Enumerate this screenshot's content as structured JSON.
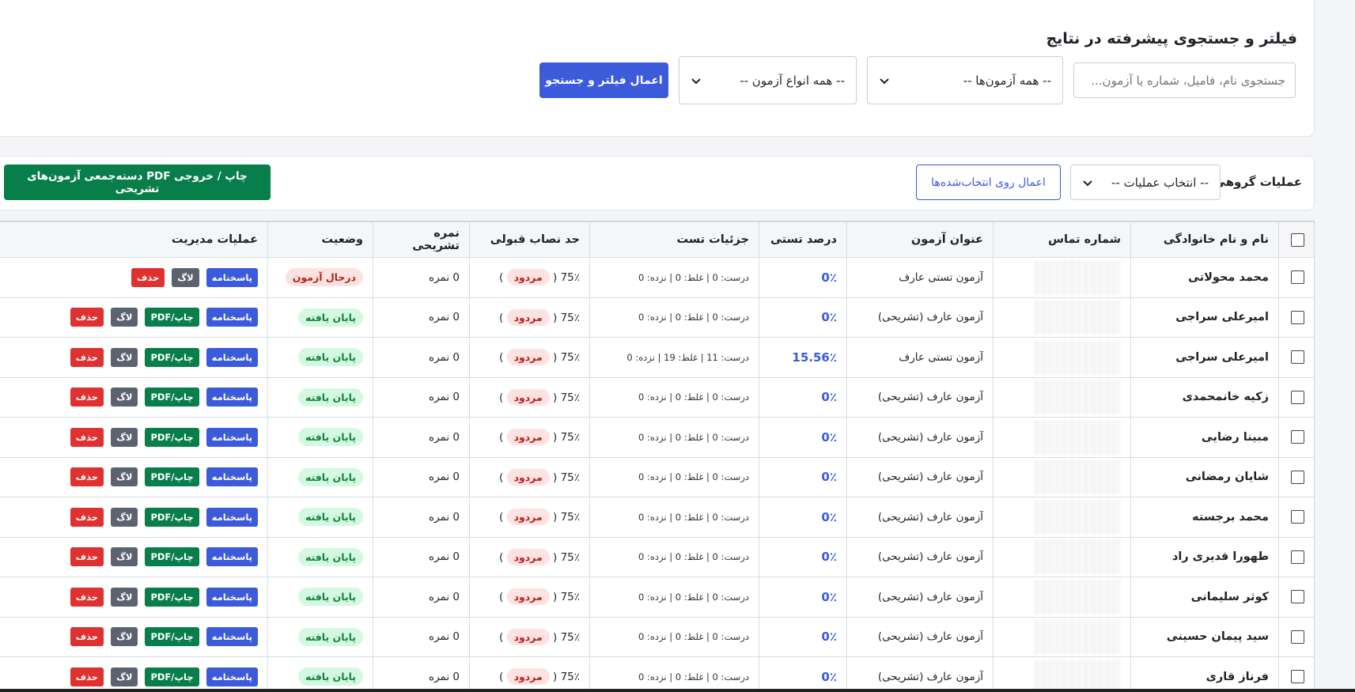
{
  "filter": {
    "title": "فیلتر و جستجوی پیشرفته در نتایج",
    "search_placeholder": "جستجوی نام، فامیل، شماره یا آزمون...",
    "exams_select": "-- همه آزمون‌ها --",
    "types_select": "-- همه انواع آزمون --",
    "apply_label": "اعمال فیلتر و جستجو"
  },
  "bulk": {
    "label": "عملیات گروهی:",
    "select": "-- انتخاب عملیات --",
    "apply_label": "اعمال روی انتخاب‌شده‌ها",
    "pdf_label": "چاپ / خروجی PDF دسته‌جمعی آزمون‌های تشریحی"
  },
  "table": {
    "headers": {
      "name": "نام و نام خانوادگی",
      "phone": "شماره تماس",
      "title": "عنوان آزمون",
      "pct": "درصد تستی",
      "detail": "جزئیات تست",
      "pass": "حد نصاب قبولی",
      "desc": "نمره تشریحی",
      "status": "وضعیت",
      "ops": "عملیات مدیریت"
    },
    "buttons": {
      "ans": "پاسخنامه",
      "pdf": "چاپ/PDF",
      "log": "لاگ",
      "del": "حذف"
    },
    "rows": [
      {
        "name": "محمد محولاتی",
        "title": "آزمون تستی عارف",
        "pct": "0٪",
        "detail": "درست: 0 | غلط: 0 | نزده: 0",
        "pass": "75٪ (",
        "reject": "مردود",
        "close": ")",
        "desc": "0 نمره",
        "status": "درحال آزمون"
      },
      {
        "name": "امیرعلی سراجی",
        "title": "آزمون عارف (تشریحی)",
        "pct": "0٪",
        "detail": "درست: 0 | غلط: 0 | نزده: 0",
        "pass": "75٪ (",
        "reject": "مردود",
        "close": ")",
        "desc": "0 نمره",
        "status": "پایان یافته"
      },
      {
        "name": "امیرعلی سراجی",
        "title": "آزمون تستی عارف",
        "pct": "15.56٪",
        "detail": "درست: 11 | غلط: 19 | نزده: 0",
        "pass": "75٪ (",
        "reject": "مردود",
        "close": ")",
        "desc": "0 نمره",
        "status": "پایان یافته"
      },
      {
        "name": "زکیه خانمحمدی",
        "title": "آزمون عارف (تشریحی)",
        "pct": "0٪",
        "detail": "درست: 0 | غلط: 0 | نزده: 0",
        "pass": "75٪ (",
        "reject": "مردود",
        "close": ")",
        "desc": "0 نمره",
        "status": "پایان یافته"
      },
      {
        "name": "مبینا رضایی",
        "title": "آزمون عارف (تشریحی)",
        "pct": "0٪",
        "detail": "درست: 0 | غلط: 0 | نزده: 0",
        "pass": "75٪ (",
        "reject": "مردود",
        "close": ")",
        "desc": "0 نمره",
        "status": "پایان یافته"
      },
      {
        "name": "شایان رمضانی",
        "title": "آزمون عارف (تشریحی)",
        "pct": "0٪",
        "detail": "درست: 0 | غلط: 0 | نزده: 0",
        "pass": "75٪ (",
        "reject": "مردود",
        "close": ")",
        "desc": "0 نمره",
        "status": "پایان یافته"
      },
      {
        "name": "محمد برجسته",
        "title": "آزمون عارف (تشریحی)",
        "pct": "0٪",
        "detail": "درست: 0 | غلط: 0 | نزده: 0",
        "pass": "75٪ (",
        "reject": "مردود",
        "close": ")",
        "desc": "0 نمره",
        "status": "پایان یافته"
      },
      {
        "name": "طهورا قدیری راد",
        "title": "آزمون عارف (تشریحی)",
        "pct": "0٪",
        "detail": "درست: 0 | غلط: 0 | نزده: 0",
        "pass": "75٪ (",
        "reject": "مردود",
        "close": ")",
        "desc": "0 نمره",
        "status": "پایان یافته"
      },
      {
        "name": "کوثر سلیمانی",
        "title": "آزمون عارف (تشریحی)",
        "pct": "0٪",
        "detail": "درست: 0 | غلط: 0 | نزده: 0",
        "pass": "75٪ (",
        "reject": "مردود",
        "close": ")",
        "desc": "0 نمره",
        "status": "پایان یافته"
      },
      {
        "name": "سید پیمان حسینی",
        "title": "آزمون عارف (تشریحی)",
        "pct": "0٪",
        "detail": "درست: 0 | غلط: 0 | نزده: 0",
        "pass": "75٪ (",
        "reject": "مردود",
        "close": ")",
        "desc": "0 نمره",
        "status": "پایان یافته"
      },
      {
        "name": "فرناز قاری",
        "title": "آزمون عارف (تشریحی)",
        "pct": "0٪",
        "detail": "درست: 0 | غلط: 0 | نزده: 0",
        "pass": "75٪ (",
        "reject": "مردود",
        "close": ")",
        "desc": "0 نمره",
        "status": "پایان یافته"
      }
    ]
  },
  "colors": {
    "primary": "#3b5bdb",
    "success": "#087f4a",
    "danger": "#e03131",
    "secondary": "#5c6370"
  }
}
